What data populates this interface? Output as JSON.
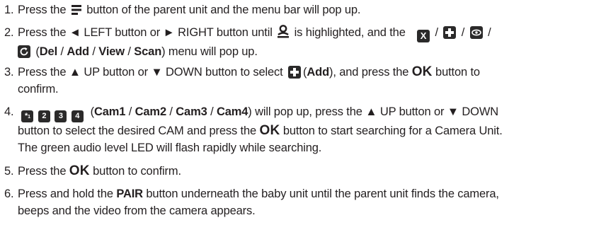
{
  "steps": [
    {
      "n": "1.",
      "a": "Press the",
      "b": "button of the parent unit and the menu bar will pop up."
    },
    {
      "n": "2.",
      "a": "Press the",
      "b": "◄ LEFT button or ► RIGHT button until",
      "c": "is highlighted, and the",
      "sep": "/",
      "del": "Del",
      "add": "Add",
      "view": "View",
      "scan": "Scan",
      "menu_tail": "menu will pop up."
    },
    {
      "n": "3.",
      "a": "Press the ▲ UP button or ▼ DOWN button to select",
      "add": "Add",
      "b": "and press the",
      "ok": "OK",
      "c": "button to",
      "d": "confirm."
    },
    {
      "n": "4.",
      "cams": [
        "Cam1",
        "Cam2",
        "Cam3",
        "Cam4"
      ],
      "a": "will pop up, press the ▲ UP button or ▼ DOWN",
      "b": "button to select the desired CAM and press the",
      "ok": "OK",
      "c": "button to start searching for a Camera Unit.",
      "d": "The green audio level LED will flash rapidly while searching."
    },
    {
      "n": "5.",
      "a": "Press the",
      "ok": "OK",
      "b": "button to confirm."
    },
    {
      "n": "6.",
      "a": "Press and hold the",
      "pair": "PAIR",
      "b": "button underneath the baby unit until the parent unit finds the camera,",
      "c": "beeps and the video from the camera appears."
    }
  ],
  "icons": {
    "menu": "menu-icon",
    "pair_user": "user-pair-icon",
    "del": "delete-x-icon",
    "add": "add-plus-icon",
    "view": "view-eye-icon",
    "scan": "scan-refresh-icon",
    "cam_labels": [
      "*1",
      "2",
      "3",
      "4"
    ]
  }
}
